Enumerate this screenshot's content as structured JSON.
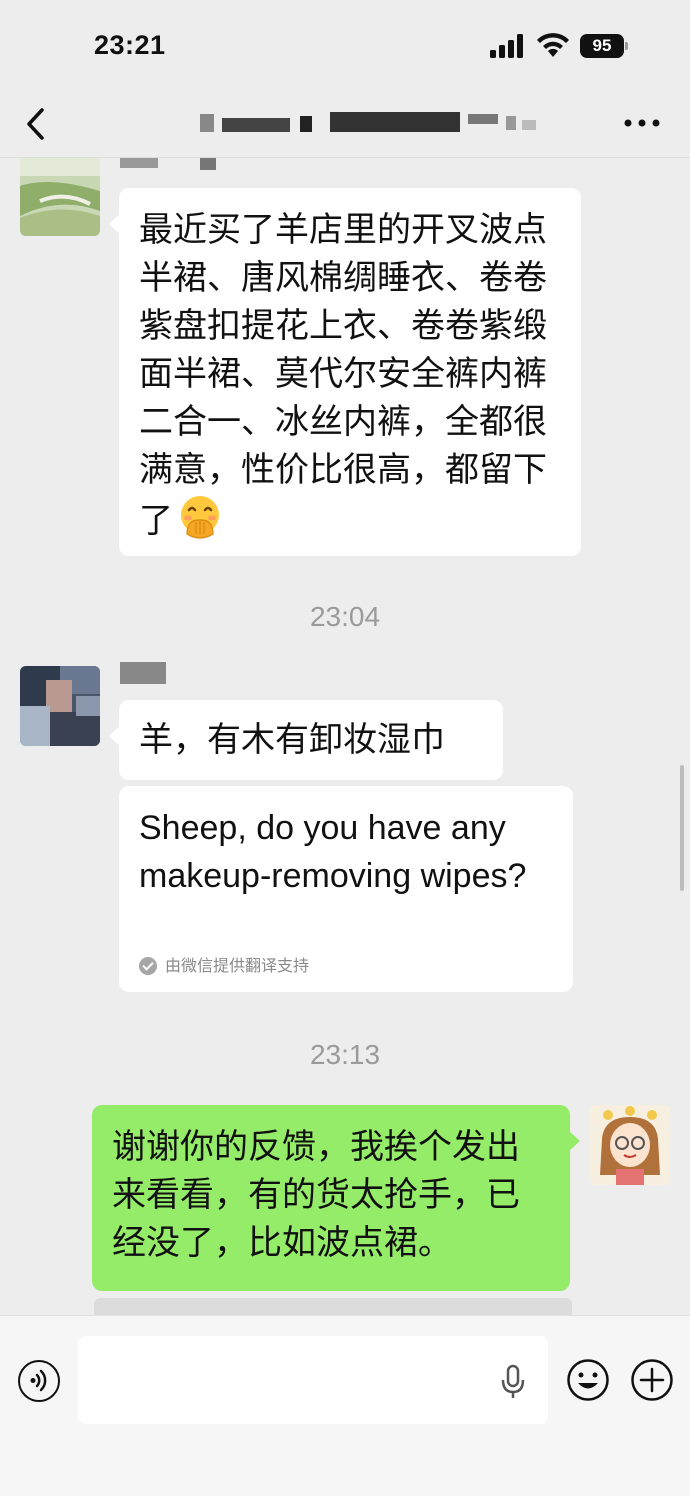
{
  "status_bar": {
    "time": "23:21",
    "battery": "95"
  },
  "nav": {
    "title_obscured": true
  },
  "messages": [
    {
      "id": "m1",
      "side": "left",
      "text": "最近买了羊店里的开叉波点半裙、唐风棉绸睡衣、卷卷紫盘扣提花上衣、卷卷紫缎面半裙、莫代尔安全裤内裤二合一、冰丝内裤，全都很满意，性价比很高，都留下了",
      "emoji": "face-with-hand-over-mouth"
    },
    {
      "id": "t1",
      "type": "timestamp",
      "text": "23:04"
    },
    {
      "id": "m2",
      "side": "left",
      "text": "羊，有木有卸妆湿巾"
    },
    {
      "id": "m3",
      "side": "left",
      "type": "translation",
      "text": "Sheep, do you have any makeup-removing wipes?",
      "note": "由微信提供翻译支持"
    },
    {
      "id": "t2",
      "type": "timestamp",
      "text": "23:13"
    },
    {
      "id": "m4",
      "side": "right",
      "text": "谢谢你的反馈，我挨个发出来看看，有的货太抢手，已经没了，比如波点裙。"
    }
  ],
  "colors": {
    "background": "#ededed",
    "bubble_in": "#ffffff",
    "bubble_out": "#95ec69",
    "timestamp": "#9a9a9a"
  },
  "input_bar": {
    "placeholder": ""
  }
}
